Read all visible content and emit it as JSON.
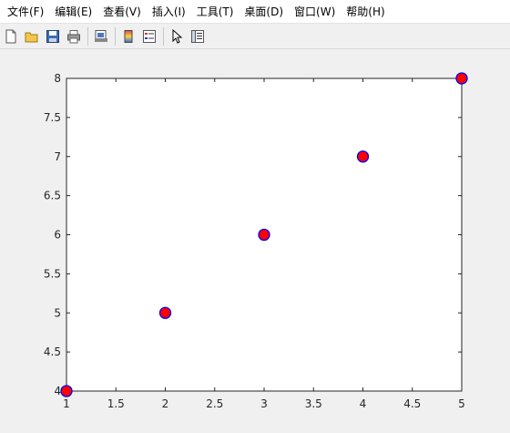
{
  "menubar": {
    "items": [
      {
        "label": "文件(F)"
      },
      {
        "label": "编辑(E)"
      },
      {
        "label": "查看(V)"
      },
      {
        "label": "插入(I)"
      },
      {
        "label": "工具(T)"
      },
      {
        "label": "桌面(D)"
      },
      {
        "label": "窗口(W)"
      },
      {
        "label": "帮助(H)"
      }
    ]
  },
  "toolbar": {
    "icons": [
      "new-file-icon",
      "open-folder-icon",
      "save-icon",
      "print-icon",
      "print-preview-icon",
      "colorbar-icon",
      "legend-icon",
      "select-pointer-icon",
      "property-editor-icon"
    ]
  },
  "colors": {
    "marker_face": "#ff0000",
    "marker_edge": "#0000ff",
    "axes_bg": "#ffffff",
    "figure_bg": "#f0f0f0"
  },
  "chart_data": {
    "type": "scatter",
    "x": [
      1,
      2,
      3,
      4,
      5
    ],
    "y": [
      4,
      5,
      6,
      7,
      8
    ],
    "xlim": [
      1,
      5
    ],
    "ylim": [
      4,
      8
    ],
    "xticks": [
      "1",
      "1.5",
      "2",
      "2.5",
      "3",
      "3.5",
      "4",
      "4.5",
      "5"
    ],
    "yticks": [
      "4",
      "4.5",
      "5",
      "5.5",
      "6",
      "6.5",
      "7",
      "7.5",
      "8"
    ],
    "title": "",
    "xlabel": "",
    "ylabel": "",
    "grid": false,
    "marker": "circle"
  }
}
